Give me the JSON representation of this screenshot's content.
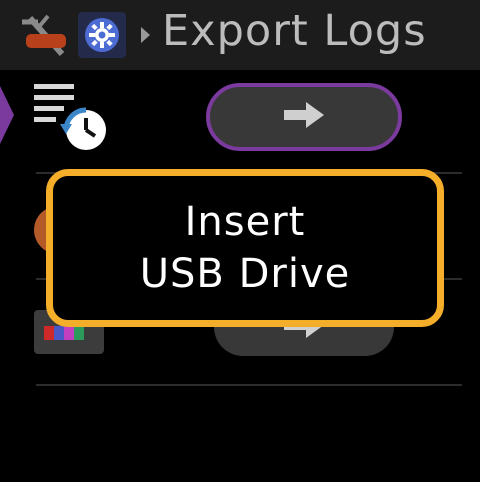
{
  "header": {
    "title": "Export Logs",
    "back_icon": "tool-icon",
    "settings_icon": "gear-icon",
    "breadcrumb_icon": "chevron-right-icon"
  },
  "rows": [
    {
      "icon": "log-history-icon",
      "action_icon": "arrow-right-icon",
      "selected": true
    },
    {
      "icon": "orange-circle-icon"
    },
    {
      "icon": "device-color-icon",
      "action_icon": "arrow-right-icon"
    }
  ],
  "dialog": {
    "line1": "Insert",
    "line2": "USB Drive"
  },
  "colors": {
    "selection": "#7b3a9e",
    "dialog_border": "#f4ae2a",
    "button_fill": "#383838",
    "header_bg": "#1c1c1c"
  }
}
